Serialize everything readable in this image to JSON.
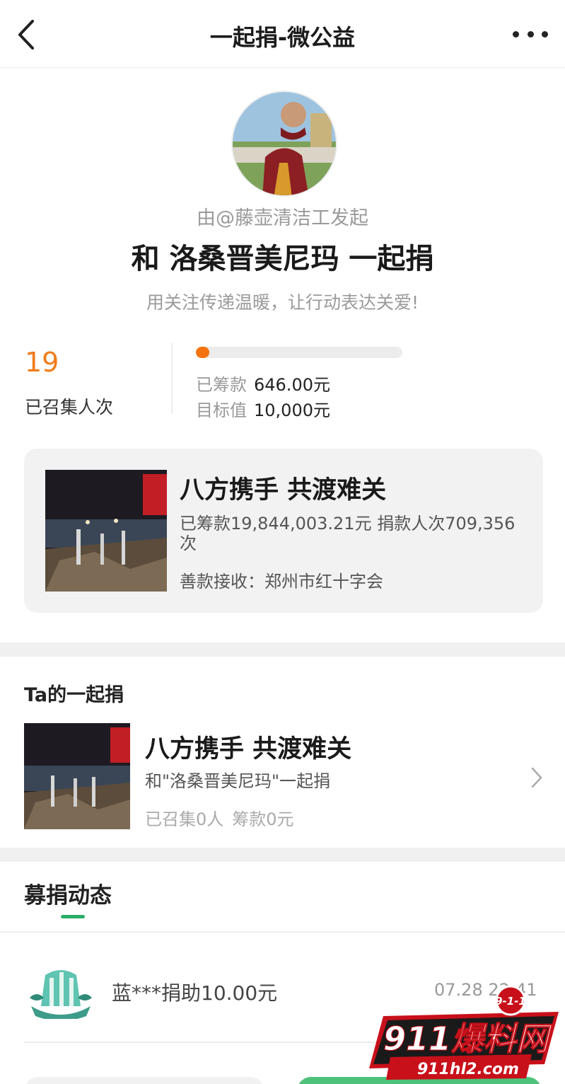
{
  "nav": {
    "title": "一起捐-微公益"
  },
  "header": {
    "initiator": "由@藤壶清洁工发起",
    "headline": "和 洛桑晋美尼玛 一起捐",
    "slogan": "用关注传递温暖，让行动表达关爱!"
  },
  "stats": {
    "count": "19",
    "count_label": "已召集人次",
    "progress_fraction": 0.0646,
    "raised_label": "已筹款",
    "raised_value": "646.00元",
    "goal_label": "目标值",
    "goal_value": "10,000元"
  },
  "project": {
    "title": "八方携手 共渡难关",
    "stats": "已筹款19,844,003.21元  捐款人次709,356次",
    "receiver": "善款接收：郑州市红十字会"
  },
  "my_section": {
    "title": "Ta的一起捐",
    "item_title": "八方携手 共渡难关",
    "item_sub": "和\"洛桑晋美尼玛\"一起捐",
    "item_people": "已召集0人",
    "item_amount": "筹款0元"
  },
  "feed": {
    "tab": "募捐动态",
    "entries": [
      {
        "text": "蓝***捐助10.00元",
        "time": "07.28 22:41"
      }
    ]
  },
  "watermark": {
    "badge": "9-1-1",
    "brand": "911爆料网",
    "url": "911hl2.com"
  },
  "colors": {
    "accent_orange": "#f5730f",
    "accent_green": "#2aae67"
  },
  "icons": [
    "back-arrow-icon",
    "more-dots-icon",
    "chevron-right-icon"
  ]
}
